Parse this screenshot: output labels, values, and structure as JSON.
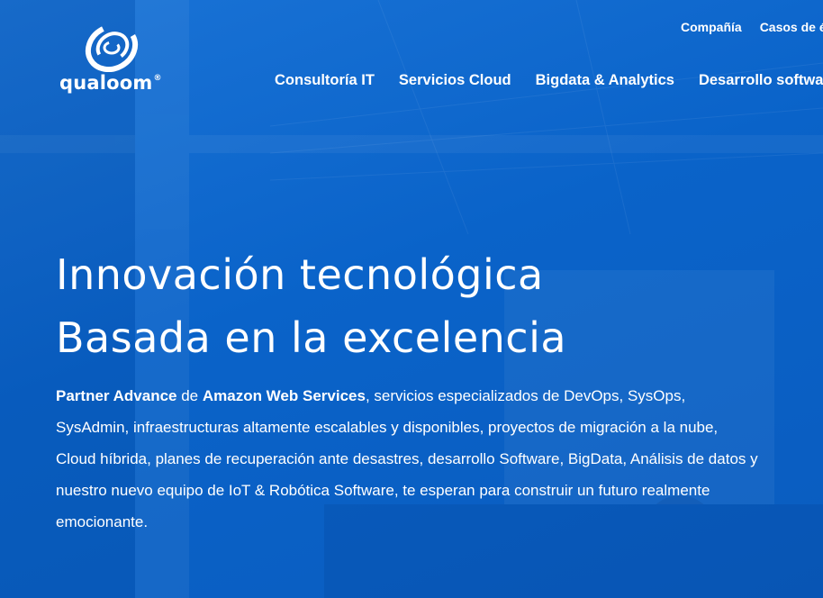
{
  "header": {
    "logo_text": "qualoom",
    "logo_mark": "®",
    "top_nav": [
      {
        "label": "Compañía"
      },
      {
        "label": "Casos de é"
      }
    ],
    "main_nav": [
      {
        "label": "Consultoría IT"
      },
      {
        "label": "Servicios Cloud"
      },
      {
        "label": "Bigdata & Analytics"
      },
      {
        "label": "Desarrollo softwar"
      }
    ]
  },
  "hero": {
    "title_line1": "Innovación tecnológica",
    "title_line2": "Basada en la excelencia",
    "desc_bold1": "Partner Advance",
    "desc_text1": " de ",
    "desc_bold2": "Amazon Web Services",
    "desc_text2": ", servicios especializados de DevOps, SysOps, SysAdmin, infraestructuras altamente escalables y disponibles, proyectos de migración a la nube, Cloud híbrida, planes de recuperación ante desastres, desarrollo Software, BigData, Análisis de datos y nuestro nuevo equipo de IoT & Robótica Software, te esperan para construir un futuro realmente emocionante."
  },
  "colors": {
    "background": "#0a63c9",
    "text": "#ffffff"
  },
  "icons": {
    "logo": "qualoom-swirl-logo-icon"
  }
}
